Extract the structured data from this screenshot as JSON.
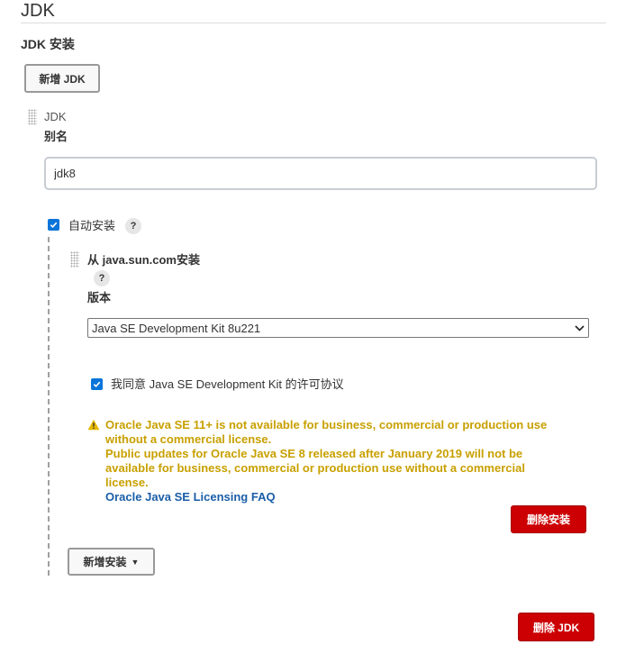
{
  "section": {
    "title": "JDK",
    "subtitle": "JDK 安装"
  },
  "toolbar": {
    "add_jdk_label": "新增 JDK"
  },
  "jdk": {
    "header_label": "JDK",
    "alias_label": "别名",
    "alias_value": "jdk8",
    "auto_install_label": "自动安装",
    "auto_install_checked": true,
    "help_glyph": "?"
  },
  "installer": {
    "title": "从 java.sun.com安装",
    "version_label": "版本",
    "version_selected": "Java SE Development Kit 8u221",
    "agree_label": "我同意 Java SE Development Kit 的许可协议",
    "agree_checked": true,
    "warning_lines": [
      "Oracle Java SE 11+ is not available for business, commercial or production use",
      "without a commercial license.",
      "Public updates for Oracle Java SE 8 released after January 2019 will not be",
      "available for business, commercial or production use without a commercial",
      "license."
    ],
    "faq_link": "Oracle Java SE Licensing FAQ",
    "delete_installer_label": "删除安装",
    "add_installer_label": "新增安装",
    "warning_color": "#c8a000"
  },
  "footer": {
    "delete_jdk_label": "删除 JDK"
  },
  "colors": {
    "danger": "#cc0003",
    "link": "#1a5ea8",
    "checkbox": "#0a74d9"
  }
}
